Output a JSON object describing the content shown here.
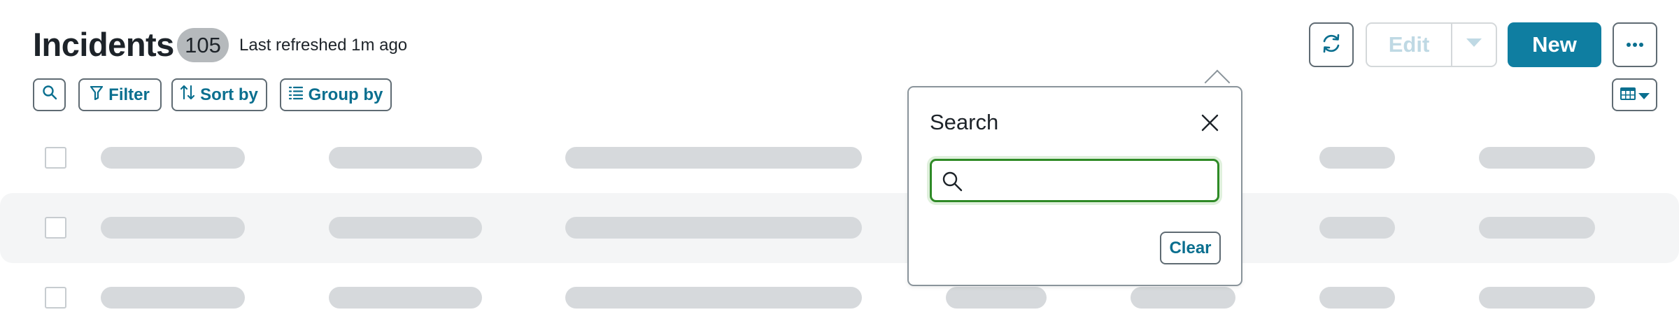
{
  "header": {
    "title": "Incidents",
    "count": "105",
    "refreshed": "Last refreshed 1m ago"
  },
  "actions": {
    "refresh_icon": "refresh-icon",
    "edit_label": "Edit",
    "new_label": "New",
    "more_icon": "more-icon"
  },
  "toolbar": {
    "search_icon": "search-icon",
    "filter_label": "Filter",
    "sort_label": "Sort by",
    "group_label": "Group by",
    "columns_icon": "table-icon"
  },
  "search_popover": {
    "title": "Search",
    "input_value": "",
    "clear_label": "Clear"
  },
  "table": {
    "row_count": 3,
    "state": "loading"
  },
  "colors": {
    "accent": "#0f7ea1",
    "link": "#0a6f8f",
    "focus": "#2e8a26",
    "skeleton": "#d6d9dc",
    "badge": "#b5b9bc"
  }
}
